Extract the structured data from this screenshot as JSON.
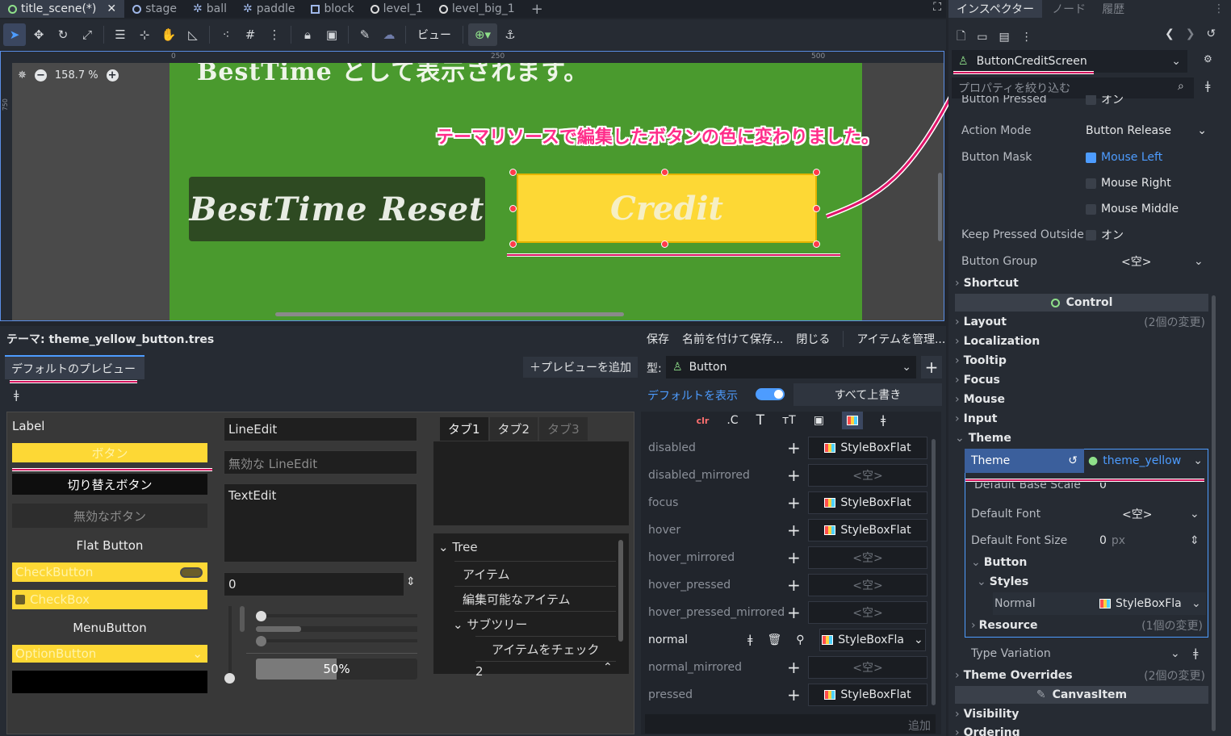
{
  "tabs": {
    "items": [
      {
        "label": "title_scene(*)"
      },
      {
        "label": "stage"
      },
      {
        "label": "ball"
      },
      {
        "label": "paddle"
      },
      {
        "label": "block"
      },
      {
        "label": "level_1"
      },
      {
        "label": "level_big_1"
      }
    ],
    "close": "✕",
    "add": "+"
  },
  "toolbar": {
    "view_label": "ビュー"
  },
  "viewport": {
    "zoom": "158.7 %",
    "ruler": {
      "t0": "0",
      "t250": "250",
      "t500": "500",
      "left": "750"
    },
    "top_text": "BestTime として表示されます。",
    "besttime_button": "BestTime Reset",
    "credit_button": "Credit",
    "annotation": "テーマリソースで編集したボタンの色に変わりました。"
  },
  "theme_panel": {
    "title": "テーマ: theme_yellow_button.tres",
    "save": "保存",
    "save_as": "名前を付けて保存...",
    "close": "閉じる",
    "manage": "アイテムを管理...",
    "default_preview_tab": "デフォルトのプレビュー",
    "add_preview": "＋プレビューを追加",
    "type_label": "型:",
    "type_value": "Button",
    "show_default": "デフォルトを表示",
    "override_all": "すべて上書き",
    "add_label": "追加",
    "preview": {
      "label": "Label",
      "button": "ボタン",
      "toggle_button": "切り替えボタン",
      "disabled_button": "無効なボタン",
      "flat_button": "Flat Button",
      "check_button": "CheckButton",
      "checkbox": "CheckBox",
      "menu_button": "MenuButton",
      "option_button": "OptionButton",
      "line_edit": "LineEdit",
      "disabled_line_edit": "無効な LineEdit",
      "text_edit": "TextEdit",
      "spin_value": "0",
      "progress": "50%",
      "progress_value": 0.5,
      "tab1": "タブ1",
      "tab2": "タブ2",
      "tab3": "タブ3",
      "tree_root": "Tree",
      "tree_item": "アイテム",
      "tree_editable": "編集可能なアイテム",
      "tree_subtree": "サブツリー",
      "tree_check": "アイテムをチェック",
      "tree_more": "2"
    },
    "styles": [
      {
        "name": "disabled",
        "value": "StyleBoxFlat",
        "set": true
      },
      {
        "name": "disabled_mirrored",
        "value": "<空>",
        "set": false
      },
      {
        "name": "focus",
        "value": "StyleBoxFlat",
        "set": true
      },
      {
        "name": "hover",
        "value": "StyleBoxFlat",
        "set": true
      },
      {
        "name": "hover_mirrored",
        "value": "<空>",
        "set": false
      },
      {
        "name": "hover_pressed",
        "value": "<空>",
        "set": false
      },
      {
        "name": "hover_pressed_mirrored",
        "value": "<空>",
        "set": false
      },
      {
        "name": "normal",
        "value": "StyleBoxFla",
        "set": true
      },
      {
        "name": "normal_mirrored",
        "value": "<空>",
        "set": false
      },
      {
        "name": "pressed",
        "value": "StyleBoxFlat",
        "set": true
      }
    ]
  },
  "inspector": {
    "tab_inspector": "インスペクター",
    "tab_node": "ノード",
    "tab_history": "履歴",
    "object": "ButtonCreditScreen",
    "filter_placeholder": "プロパティを絞り込む",
    "button_pressed": "Button Pressed",
    "button_pressed_val": "オン",
    "action_mode": "Action Mode",
    "action_mode_val": "Button Release",
    "button_mask": "Button Mask",
    "mouse_left": "Mouse Left",
    "mouse_right": "Mouse Right",
    "mouse_middle": "Mouse Middle",
    "keep_pressed": "Keep Pressed Outside",
    "keep_pressed_val": "オン",
    "button_group": "Button Group",
    "button_group_val": "<空>",
    "shortcut": "Shortcut",
    "control": "Control",
    "layout": "Layout",
    "layout_changes": "(2個の変更)",
    "localization": "Localization",
    "tooltip": "Tooltip",
    "focus": "Focus",
    "mouse": "Mouse",
    "input": "Input",
    "theme": "Theme",
    "theme_prop": "Theme",
    "theme_val": "theme_yellow",
    "default_base_scale": "Default Base Scale",
    "default_base_scale_val": "0",
    "default_font": "Default Font",
    "default_font_val": "<空>",
    "default_font_size": "Default Font Size",
    "default_font_size_val": "0",
    "px": "px",
    "button_sub": "Button",
    "styles_sub": "Styles",
    "normal": "Normal",
    "normal_val": "StyleBoxFla",
    "resource": "Resource",
    "resource_changes": "(1個の変更)",
    "type_variation": "Type Variation",
    "theme_overrides": "Theme Overrides",
    "theme_overrides_changes": "(2個の変更)",
    "canvas_item": "CanvasItem",
    "visibility": "Visibility",
    "ordering": "Ordering"
  }
}
